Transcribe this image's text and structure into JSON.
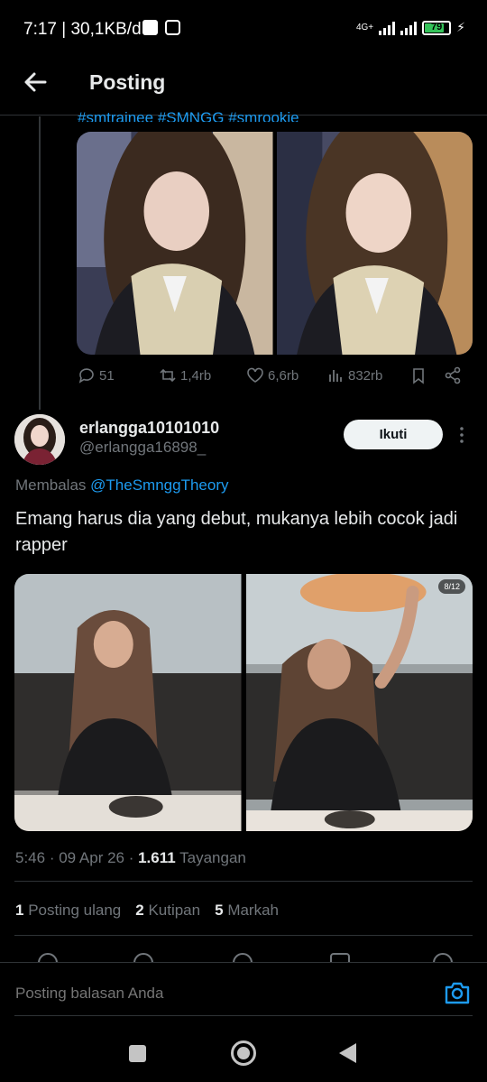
{
  "status_bar": {
    "time": "7:17",
    "speed": "30,1KB/d",
    "network": "4G+",
    "battery": "79",
    "battery_level": 0.79,
    "battery_color": "#35c25a"
  },
  "header": {
    "back_icon": "arrow-left-icon",
    "title": "Posting"
  },
  "parent_post": {
    "hashtags": "#smtrainee #SMNGG #smrookie",
    "images": 2,
    "actions": {
      "replies": "51",
      "reposts": "1,4rb",
      "likes": "6,6rb",
      "views": "832rb"
    }
  },
  "reply_post": {
    "display_name": "erlangga10101010",
    "handle": "@erlangga16898_",
    "follow_label": "Ikuti",
    "replying_prefix": "Membalas",
    "replying_to": "@TheSmnggTheory",
    "text": "Emang harus dia yang debut, mukanya lebih cocok jadi rapper",
    "image_badge": "8/12",
    "time": "5:46",
    "date": "09 Apr 26",
    "views_count": "1.611",
    "views_label": "Tayangan",
    "stats": [
      {
        "count": "1",
        "label": "Posting ulang"
      },
      {
        "count": "2",
        "label": "Kutipan"
      },
      {
        "count": "5",
        "label": "Markah"
      }
    ]
  },
  "reply_bar": {
    "placeholder": "Posting balasan Anda",
    "camera_icon": "camera-icon"
  },
  "colors": {
    "background": "#000000",
    "accent": "#1d9bf0",
    "muted": "#71767b",
    "text": "#e7e9ea"
  }
}
